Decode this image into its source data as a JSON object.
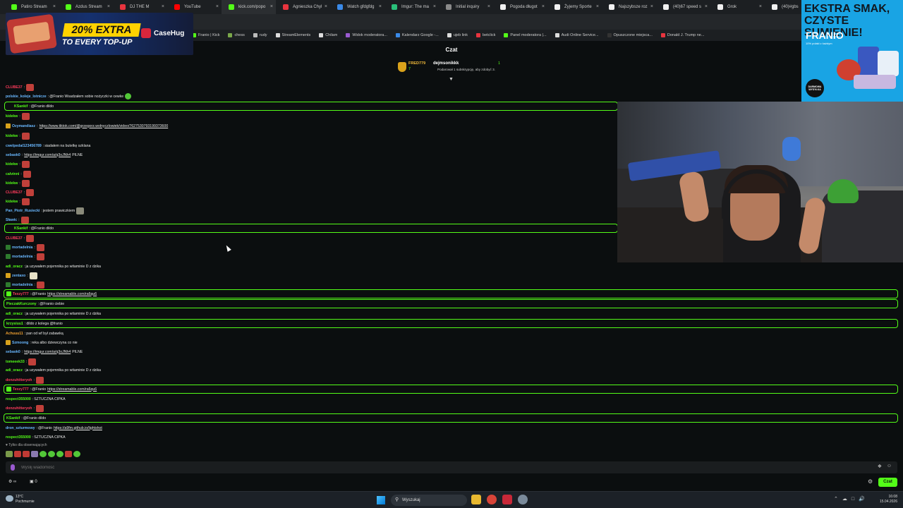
{
  "browser": {
    "tabs": [
      {
        "title": "Patiro Stream",
        "color": "#53fc18"
      },
      {
        "title": "Azdus Stream",
        "color": "#53fc18"
      },
      {
        "title": "DJ THE M",
        "color": "#e8343e"
      },
      {
        "title": "YouTube",
        "color": "#ff0000"
      },
      {
        "title": "kick.com/popo",
        "color": "#53fc18",
        "active": true
      },
      {
        "title": "Agnieszka Chyl",
        "color": "#e8343e"
      },
      {
        "title": "Watch gfdgfdg",
        "color": "#3a8ae8"
      },
      {
        "title": "Imgur: The ma",
        "color": "#2ac07a"
      },
      {
        "title": "Initial inquiry",
        "color": "#8a8a8a"
      },
      {
        "title": "Pogoda długot",
        "color": "#f0f0f0"
      },
      {
        "title": "Żyjemy Sporte",
        "color": "#f0f0f0"
      },
      {
        "title": "Najszybsze roz",
        "color": "#f0f0f0"
      },
      {
        "title": "(40)67 speed s",
        "color": "#f0f0f0"
      },
      {
        "title": "Grok",
        "color": "#f0f0f0"
      },
      {
        "title": "(40)#gbs",
        "color": "#f0f0f0"
      }
    ],
    "bookmarks": [
      {
        "label": "Franio | Kick",
        "color": "#53fc18"
      },
      {
        "label": "chess",
        "color": "#7aa84a"
      },
      {
        "label": "rudy",
        "color": "#bbbbbb"
      },
      {
        "label": "StreamElements",
        "color": "#dddddd"
      },
      {
        "label": "Chilam",
        "color": "#dddddd"
      },
      {
        "label": "Widok moderatora...",
        "color": "#9a5ad0"
      },
      {
        "label": "Kalendarz Google -...",
        "color": "#3a8ae8"
      },
      {
        "label": "ujeb link",
        "color": "#dddddd"
      },
      {
        "label": "betclick",
        "color": "#e8343e"
      },
      {
        "label": "Panel moderatora |...",
        "color": "#53fc18"
      },
      {
        "label": "Audi Online Service...",
        "color": "#dddddd"
      },
      {
        "label": "Opuszczone miejsca...",
        "color": "#333333"
      },
      {
        "label": "Donald J. Trump ne...",
        "color": "#e8343e"
      }
    ]
  },
  "ad_left": {
    "headline": "20% EXTRA",
    "sub": "TO EVERY TOP-UP",
    "brand": "CaseHug"
  },
  "ad_right": {
    "line1": "EKSTRA SMAK,",
    "line1b": "CZYSTE SUMIENIE!",
    "line2": "FRANIO",
    "line3": "10% polaki z każdym",
    "badge": "DARMOWA WYSYŁKA"
  },
  "chat": {
    "title": "Czat",
    "pinned": {
      "gifter": "FRED779",
      "gifter_count": "7",
      "user": "dejmsonikkk",
      "user_count": "1",
      "note": "Podarował 1 subskrypcję, aby zdobyć 3."
    },
    "messages": [
      {
        "user": "CLUBE37",
        "color": "#ff3b5c",
        "emote": "e"
      },
      {
        "user": "polskie_koleje_lotnicze",
        "color": "#6ab8ff",
        "text": "@Franio Wsadzałem sobie nożyczki w cewke",
        "emote": "g"
      },
      {
        "user": "KSankif",
        "color": "#53fc18",
        "text": "@Franio dildo",
        "highlight": "short"
      },
      {
        "user": "kidekw",
        "color": "#53fc18",
        "emote": "e"
      },
      {
        "user": "Ozymandiasz",
        "color": "#6ab8ff",
        "badge": "#d9a21b",
        "link": "https://www.tiktok.com/@grzegorz.wolnyczlowiek/video/7627530793199373600"
      },
      {
        "user": "kidekw",
        "color": "#53fc18",
        "emote": "e"
      },
      {
        "user": "cwelpedal123456789",
        "color": "#6ab8ff",
        "text": "siadałem na butelkę szklana"
      },
      {
        "user": "sebaok0",
        "color": "#6ab8ff",
        "link": "https://imgur.com/a/q3oJNh4",
        "text2": "PILNE"
      },
      {
        "user": "kidekw",
        "color": "#53fc18",
        "emote": "e"
      },
      {
        "user": "calvinni",
        "color": "#53fc18",
        "emote": "e"
      },
      {
        "user": "kidekw",
        "color": "#53fc18",
        "emote": "e"
      },
      {
        "user": "CLUBE37",
        "color": "#ff3b5c",
        "emote": "e"
      },
      {
        "user": "kidekw",
        "color": "#53fc18",
        "emote": "e"
      },
      {
        "user": "Pan_Piotr_Rusiecki",
        "color": "#6ab8ff",
        "text": "jestem prawiczkiem",
        "emote": "gr"
      },
      {
        "user": "Sławic",
        "color": "#6ab8ff",
        "emote": "e"
      },
      {
        "user": "KSankif",
        "color": "#53fc18",
        "text": "@Franio dildo",
        "highlight": "short"
      },
      {
        "user": "CLUBE37",
        "color": "#ff3b5c",
        "emote": "e"
      },
      {
        "user": "mortadelnia",
        "color": "#6ab8ff",
        "emote": "e",
        "badge": "#2e7a2e"
      },
      {
        "user": "mortadelnia",
        "color": "#6ab8ff",
        "emote": "e",
        "badge": "#2e7a2e"
      },
      {
        "user": "adi_oracz",
        "color": "#53fc18",
        "text": "ja uzywałem pojemnika po witaminie D z dzika"
      },
      {
        "user": "zentaxo",
        "color": "#6ab8ff",
        "badge": "#d9a21b",
        "emote": "w"
      },
      {
        "user": "mortadelnia",
        "color": "#6ab8ff",
        "emote": "e",
        "badge": "#2e7a2e"
      },
      {
        "user": "Texzy777",
        "color": "#ff3b5c",
        "text": "@Franio",
        "link": "https://streamable.com/ra6qu6",
        "highlight": "wide",
        "badge": "#53fc18"
      },
      {
        "user": "PieczakKurczony",
        "color": "#53fc18",
        "text": "@Franio ciebie",
        "highlight": "wide"
      },
      {
        "user": "adi_oracz",
        "color": "#53fc18",
        "text": "ja uzywałem pojemnika po witaminie D z dzika"
      },
      {
        "user": "krzysiuu1",
        "color": "#53fc18",
        "text": "dildo z kolega @franio",
        "highlight": "wide"
      },
      {
        "user": "Achuuu11",
        "color": "#f0a030",
        "text": "pan od wf był zabawką"
      },
      {
        "user": "Szmoong",
        "color": "#6ab8ff",
        "text": "reka albo dziewczyna co nie",
        "badge": "#d9a21b"
      },
      {
        "user": "sebaok0",
        "color": "#6ab8ff",
        "link": "https://imgur.com/a/q3oJNh4",
        "text2": "PILNE"
      },
      {
        "user": "tomeeek33",
        "color": "#53fc18",
        "emote": "e"
      },
      {
        "user": "adi_oracz",
        "color": "#53fc18",
        "text": "ja uzywałem pojemnika po witaminie D z dzika"
      },
      {
        "user": "donzuhitteryoh",
        "color": "#ff3b5c",
        "emote": "e"
      },
      {
        "user": "Texzy777",
        "color": "#ff3b5c",
        "text": "@Franio",
        "link": "https://streamable.com/ra6qu6",
        "highlight": "wide",
        "badge": "#53fc18"
      },
      {
        "user": "respect355000",
        "color": "#53fc18",
        "text": "SZTUCZNA CIPKA"
      },
      {
        "user": "donzuhitteryoh",
        "color": "#ff3b5c",
        "emote": "e"
      },
      {
        "user": "KSankif",
        "color": "#53fc18",
        "text": "@Franio dildo",
        "highlight": "wide"
      },
      {
        "user": "dron_szturmowy",
        "color": "#6ab8ff",
        "text": "@Franio",
        "link": "https://a9fm.github.io/lightshot"
      },
      {
        "user": "respect355000",
        "color": "#53fc18",
        "text": "SZTUCZNA CIPKA"
      }
    ],
    "followers_label": "Tylko dla obserwujących",
    "composer_placeholder": "Wyślij wiadomość",
    "footer_left": "∞",
    "footer_count": "0",
    "send_label": "Czat"
  },
  "taskbar": {
    "temp": "13°C",
    "weather": "Pochmurnie",
    "search": "Wyszukaj",
    "time": "16:08",
    "date": "15.04.2026"
  }
}
